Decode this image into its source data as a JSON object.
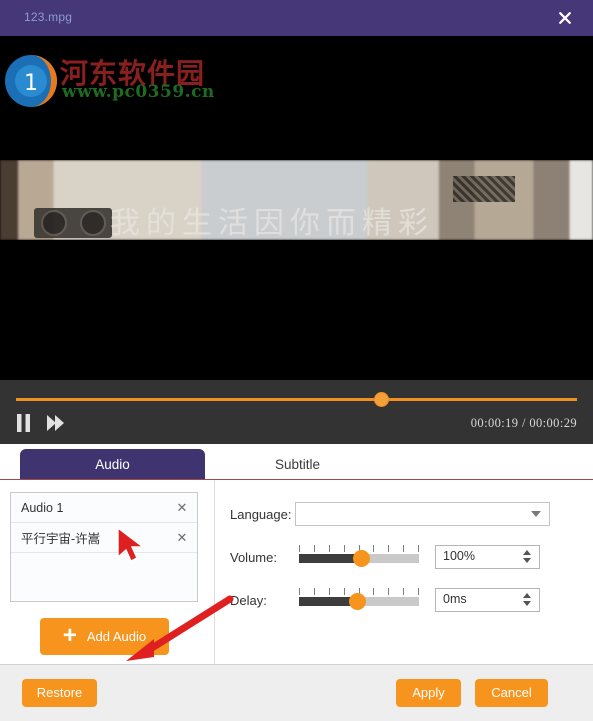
{
  "window": {
    "title": "123.mpg",
    "close_icon": "close-icon",
    "accent_purple": "#453778",
    "accent_orange": "#f7941e"
  },
  "watermark": {
    "site_name": "河东软件园",
    "url": "www.pc0359.cn"
  },
  "video": {
    "caption": "我的生活因你而精彩"
  },
  "player": {
    "pause_icon": "pause-icon",
    "forward_icon": "fast-forward-icon",
    "current_time": "00:00:19",
    "separator": "/",
    "total_time": "00:00:29",
    "time_display": "00:00:19 / 00:00:29",
    "progress_percent": 65
  },
  "tabs": [
    {
      "label": "Audio",
      "active": true
    },
    {
      "label": "Subtitle",
      "active": false
    }
  ],
  "audio_panel": {
    "items": [
      {
        "label": "Audio 1",
        "remove_icon": "close-icon"
      },
      {
        "label": "平行宇宙-许嵩",
        "remove_icon": "close-icon"
      }
    ],
    "add_button": {
      "label": "Add Audio",
      "icon": "plus-icon"
    }
  },
  "form": {
    "language": {
      "label": "Language:",
      "value": "",
      "placeholder": ""
    },
    "volume": {
      "label": "Volume:",
      "value": "100%",
      "slider_percent": 52
    },
    "delay": {
      "label": "Delay:",
      "value": "0ms",
      "slider_percent": 48
    }
  },
  "footer": {
    "restore": "Restore",
    "apply": "Apply",
    "cancel": "Cancel"
  }
}
